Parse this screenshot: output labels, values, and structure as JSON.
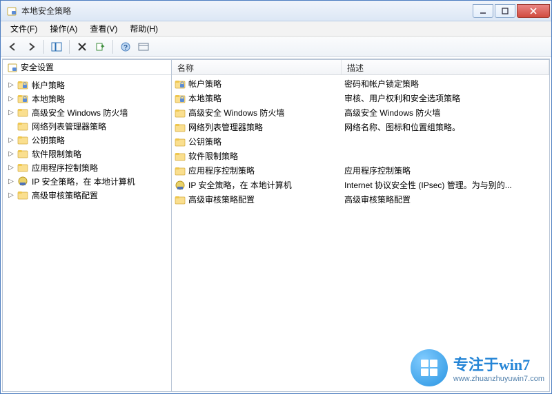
{
  "window": {
    "title": "本地安全策略"
  },
  "menus": {
    "file": "文件(F)",
    "action": "操作(A)",
    "view": "查看(V)",
    "help": "帮助(H)"
  },
  "tree": {
    "header": "安全设置",
    "items": [
      {
        "label": "帐户策略",
        "expandable": true,
        "icon": "folder-lock"
      },
      {
        "label": "本地策略",
        "expandable": true,
        "icon": "folder-lock"
      },
      {
        "label": "高级安全 Windows 防火墙",
        "expandable": true,
        "icon": "folder"
      },
      {
        "label": "网络列表管理器策略",
        "expandable": false,
        "icon": "folder"
      },
      {
        "label": "公钥策略",
        "expandable": true,
        "icon": "folder"
      },
      {
        "label": "软件限制策略",
        "expandable": true,
        "icon": "folder"
      },
      {
        "label": "应用程序控制策略",
        "expandable": true,
        "icon": "folder"
      },
      {
        "label": "IP 安全策略，在 本地计算机",
        "expandable": true,
        "icon": "ipsec"
      },
      {
        "label": "高级审核策略配置",
        "expandable": true,
        "icon": "folder"
      }
    ]
  },
  "list": {
    "columns": {
      "name": "名称",
      "desc": "描述"
    },
    "rows": [
      {
        "name": "帐户策略",
        "desc": "密码和帐户锁定策略",
        "icon": "folder-lock"
      },
      {
        "name": "本地策略",
        "desc": "审核、用户权利和安全选项策略",
        "icon": "folder-lock"
      },
      {
        "name": "高级安全 Windows 防火墙",
        "desc": "高级安全 Windows 防火墙",
        "icon": "folder"
      },
      {
        "name": "网络列表管理器策略",
        "desc": "网络名称、图标和位置组策略。",
        "icon": "folder"
      },
      {
        "name": "公钥策略",
        "desc": "",
        "icon": "folder"
      },
      {
        "name": "软件限制策略",
        "desc": "",
        "icon": "folder"
      },
      {
        "name": "应用程序控制策略",
        "desc": "应用程序控制策略",
        "icon": "folder"
      },
      {
        "name": "IP 安全策略，在 本地计算机",
        "desc": "Internet 协议安全性 (IPsec) 管理。为与别的...",
        "icon": "ipsec"
      },
      {
        "name": "高级审核策略配置",
        "desc": "高级审核策略配置",
        "icon": "folder"
      }
    ]
  },
  "watermark": {
    "big": "专注于win7",
    "small": "www.zhuanzhuyuwin7.com"
  }
}
